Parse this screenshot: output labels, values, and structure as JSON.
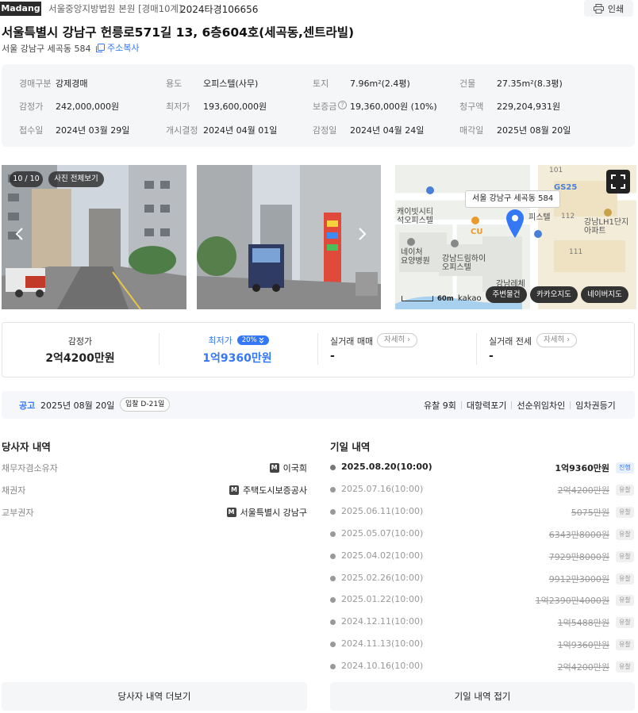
{
  "header": {
    "logo": "Madang",
    "court": "서울중앙지방법원 본원 [경매10계]",
    "case_no": "2024타경106656",
    "print_label": "인쇄",
    "title": "서울특별시 강남구 헌릉로571길 13, 6층604호(세곡동,센트라빌)",
    "address": "서울 강남구 세곡동 584",
    "copy_label": "주소복사"
  },
  "info": {
    "rows": [
      [
        {
          "label": "경매구분",
          "value": "강제경매"
        },
        {
          "label": "용도",
          "value": "오피스텔(사무)"
        },
        {
          "label": "토지",
          "value": "7.96m²(2.4평)"
        },
        {
          "label": "건물",
          "value": "27.35m²(8.3평)"
        }
      ],
      [
        {
          "label": "감정가",
          "value": "242,000,000원"
        },
        {
          "label": "최저가",
          "value": "193,600,000원"
        },
        {
          "label": "보증금",
          "value": "19,360,000원 (10%)"
        },
        {
          "label": "청구액",
          "value": "229,204,931원"
        }
      ],
      [
        {
          "label": "접수일",
          "value": "2024년 03월 29일"
        },
        {
          "label": "개시결정",
          "value": "2024년 04월 01일"
        },
        {
          "label": "감정일",
          "value": "2024년 04월 24일"
        },
        {
          "label": "매각일",
          "value": "2025년 08월 20일"
        }
      ]
    ]
  },
  "gallery": {
    "counter": "10 / 10",
    "view_all": "사진 전체보기"
  },
  "map": {
    "tooltip": "서울 강남구 세곡동 584",
    "labels": {
      "l1": "캐이빗시티",
      "l2": "석오피스텔",
      "l3": "네이처",
      "l4": "요양병원",
      "l5": "강남드림하이",
      "l6": "오피스텔",
      "l7": "피스텔",
      "l8": "강남LH1단지",
      "l9": "아파트",
      "l10": "CU",
      "l11": "GS25",
      "l12": "101",
      "l13": "112",
      "l14": "111",
      "l15": "강남레체"
    },
    "scale": "60m",
    "brand": "kakao",
    "btn_nearby": "주변물건",
    "btn_kakao": "카카오지도",
    "btn_naver": "네이버지도"
  },
  "prices": {
    "appraisal_label": "감정가",
    "appraisal_value": "2억4200만원",
    "min_label": "최저가",
    "min_pct": "20%",
    "min_value": "1억9360만원",
    "trade_label": "실거래 매매",
    "trade_value": "-",
    "rent_label": "실거래 전세",
    "rent_value": "-",
    "detail_label": "자세히",
    "accent": "#3478f6"
  },
  "notice": {
    "tag": "공고",
    "date": "2025년 08월 20일",
    "dday": "입찰 D-21일",
    "links": [
      "유찰 9회",
      "대항력포기",
      "선순위임차인",
      "임차권등기"
    ]
  },
  "parties": {
    "title": "당사자 내역",
    "items": [
      {
        "label": "채무자겸소유자",
        "badge": "M",
        "name": "이국희"
      },
      {
        "label": "채권자",
        "badge": "M",
        "name": "주택도시보증공사"
      },
      {
        "label": "교부권자",
        "badge": "M",
        "name": "서울특별시 강남구"
      }
    ],
    "more_label": "당사자 내역 더보기"
  },
  "history": {
    "title": "기일 내역",
    "items": [
      {
        "date": "2025.08.20(10:00)",
        "price": "1억9360만원",
        "status": "진행",
        "current": true
      },
      {
        "date": "2025.07.16(10:00)",
        "price": "2억4200만원",
        "status": "유찰",
        "current": false
      },
      {
        "date": "2025.06.11(10:00)",
        "price": "5075만원",
        "status": "유찰",
        "current": false
      },
      {
        "date": "2025.05.07(10:00)",
        "price": "6343만8000원",
        "status": "유찰",
        "current": false
      },
      {
        "date": "2025.04.02(10:00)",
        "price": "7929만8000원",
        "status": "유찰",
        "current": false
      },
      {
        "date": "2025.02.26(10:00)",
        "price": "9912만3000원",
        "status": "유찰",
        "current": false
      },
      {
        "date": "2025.01.22(10:00)",
        "price": "1억2390만4000원",
        "status": "유찰",
        "current": false
      },
      {
        "date": "2024.12.11(10:00)",
        "price": "1억5488만원",
        "status": "유찰",
        "current": false
      },
      {
        "date": "2024.11.13(10:00)",
        "price": "1억9360만원",
        "status": "유찰",
        "current": false
      },
      {
        "date": "2024.10.16(10:00)",
        "price": "2억4200만원",
        "status": "유찰",
        "current": false
      }
    ],
    "fold_label": "기일 내역 접기"
  }
}
